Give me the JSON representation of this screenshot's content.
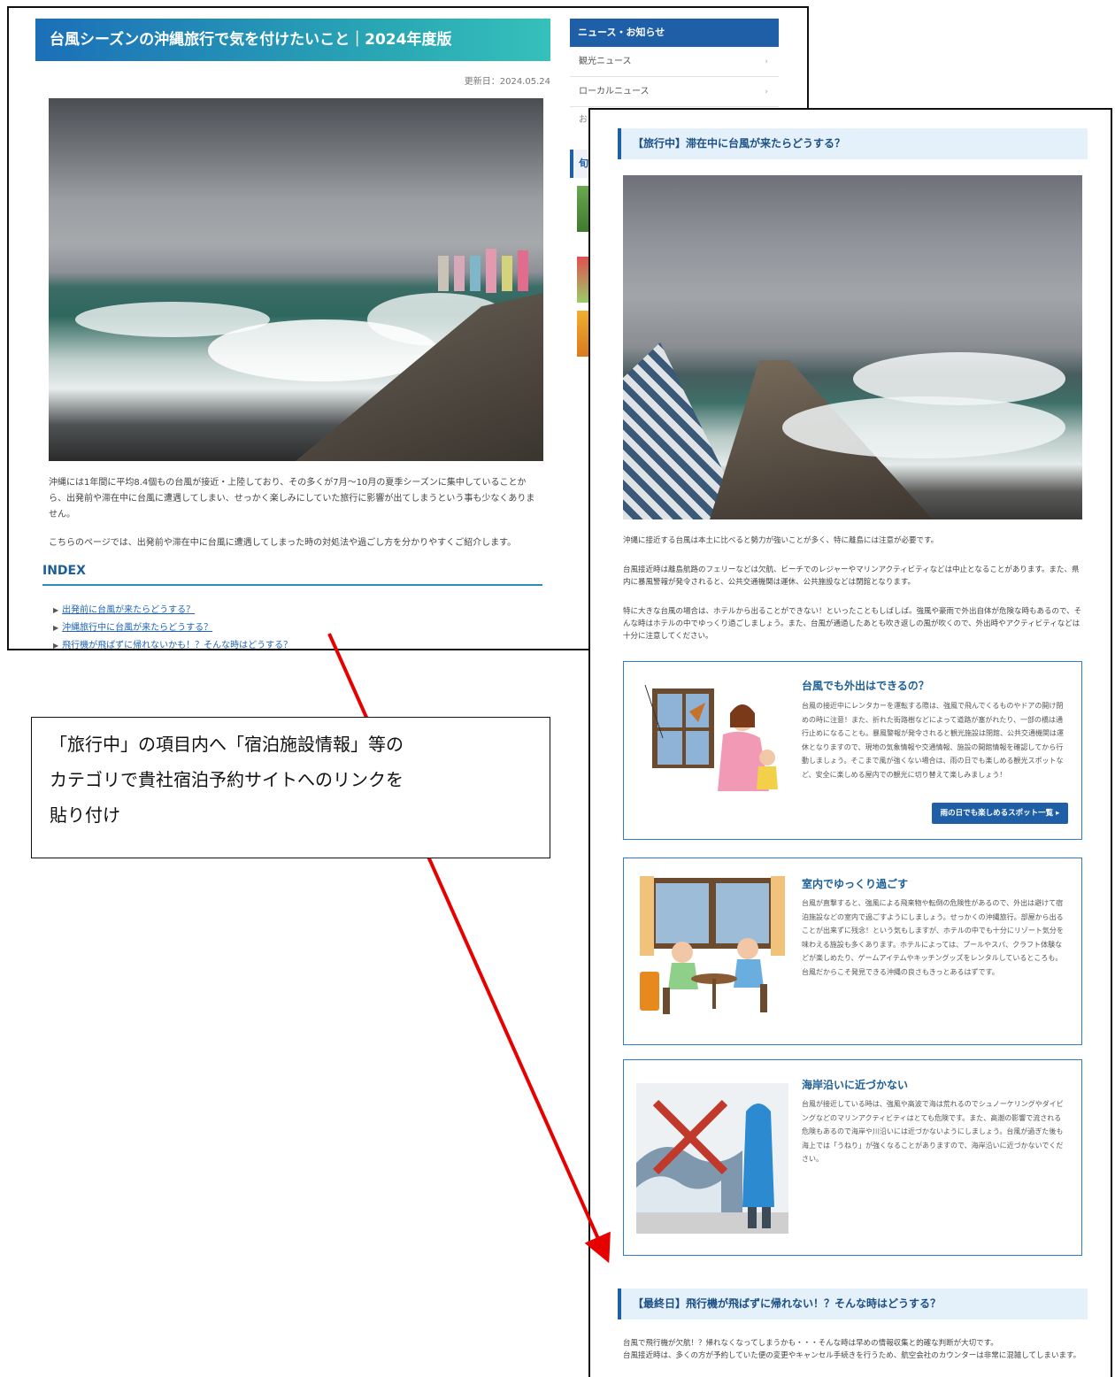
{
  "shot1": {
    "article_title": "台風シーズンの沖縄旅行で気を付けたいこと｜2024年度版",
    "updated": "更新日：2024.05.24",
    "intro_paragraph_1": "沖縄には1年間に平均8.4個もの台風が接近・上陸しており、その多くが7月～10月の夏季シーズンに集中していることから、出発前や滞在中に台風に遭遇してしまい、せっかく楽しみにしていた旅行に影響が出てしまうという事も少なくありません。",
    "intro_paragraph_2": "こちらのページでは、出発前や滞在中に台風に遭遇してしまった時の対処法や過ごし方を分かりやすくご紹介します。",
    "index_title": "INDEX",
    "index_links": [
      "出発前に台風が来たらどうする？",
      "沖縄旅行中に台風が来たらどうする？",
      "飛行機が飛ばずに帰れないかも！？そんな時はどうする？"
    ],
    "sidebar": {
      "heading": "ニュース・お知らせ",
      "items": [
        "観光ニュース",
        "ローカルニュース"
      ],
      "partial_item": "お",
      "section_partial": "旬"
    }
  },
  "shot2": {
    "section1_heading": "【旅行中】滞在中に台風が来たらどうする？",
    "para1": "沖縄に接近する台風は本土に比べると勢力が強いことが多く、特に離島には注意が必要です。",
    "para2": "台風接近時は離島航路のフェリーなどは欠航、ビーチでのレジャーやマリンアクティビティなどは中止となることがあります。また、県内に暴風警報が発令されると、公共交通機関は運休、公共施設などは閉館となります。",
    "para3": "特に大きな台風の場合は、ホテルから出ることができない！といったこともしばしば。強風や豪雨で外出自体が危険な時もあるので、そんな時はホテルの中でゆっくり過ごしましょう。また、台風が通過したあとも吹き返しの風が吹くので、外出時やアクティビティなどは十分に注意してください。",
    "cards": [
      {
        "title": "台風でも外出はできるの？",
        "body": "台風の接近中にレンタカーを運転する際は、強風で飛んでくるものやドアの開け閉めの時に注意！また、折れた街路樹などによって道路が塞がれたり、一部の橋は通行止めになることも。暴風警報が発令されると観光施設は閉館、公共交通機関は運休となりますので、現地の気象情報や交通情報、施設の開館情報を確認してから行動しましょう。そこまで風が強くない場合は、雨の日でも楽しめる観光スポットなど、安全に楽しめる屋内での観光に切り替えて楽しみましょう！",
        "cta": "雨の日でも楽しめるスポット一覧 ▸"
      },
      {
        "title": "室内でゆっくり過ごす",
        "body": "台風が直撃すると、強風による飛来物や転倒の危険性があるので、外出は避けて宿泊施設などの室内で過ごすようにしましょう。せっかくの沖縄旅行。部屋から出ることが出来ずに残念！という気もしますが、ホテルの中でも十分にリゾート気分を味わえる施設も多くあります。ホテルによっては、プールやスパ、クラフト体験などが楽しめたり、ゲームアイテムやキッチングッズをレンタルしているところも。台風だからこそ発見できる沖縄の良さもきっとあるはずです。"
      },
      {
        "title": "海岸沿いに近づかない",
        "body": "台風が接近している時は、強風や高波で海は荒れるのでシュノーケリングやダイビングなどのマリンアクティビティはとても危険です。また、高潮の影響で流される危険もあるので海岸や川沿いには近づかないようにしましょう。台風が過ぎた後も海上では「うねり」が強くなることがありますので、海岸沿いに近づかないでください。"
      }
    ],
    "section2_heading": "【最終日】飛行機が飛ばずに帰れない！？そんな時はどうする？",
    "para4": "台風で飛行機が欠航！？帰れなくなってしまうかも・・・そんな時は早めの情報収集と的確な判断が大切です。",
    "para5": "台風接近時は、多くの方が予約していた便の変更やキャンセル手続きを行うため、航空会社のカウンターは非常に混雑してしまいます。"
  },
  "callout": {
    "line1": "「旅行中」の項目内へ「宿泊施設情報」等の",
    "line2": "カテゴリで貴社宿泊予約サイトへのリンクを",
    "line3": "貼り付け"
  },
  "colors": {
    "arrow": "#e60000",
    "heading_blue": "#1e5fa8",
    "title_gradient_start": "#1b6fb8",
    "title_gradient_end": "#35c0bb"
  }
}
